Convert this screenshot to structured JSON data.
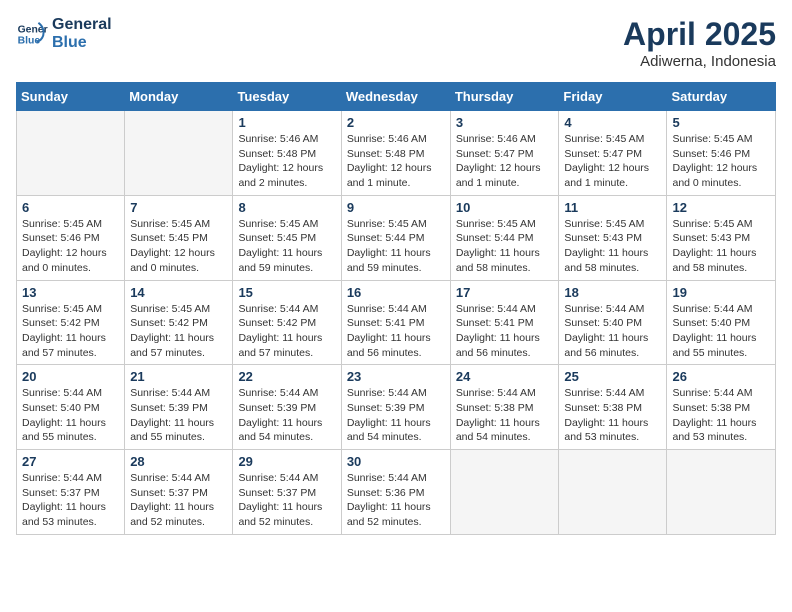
{
  "header": {
    "logo_line1": "General",
    "logo_line2": "Blue",
    "title": "April 2025",
    "subtitle": "Adiwerna, Indonesia"
  },
  "weekdays": [
    "Sunday",
    "Monday",
    "Tuesday",
    "Wednesday",
    "Thursday",
    "Friday",
    "Saturday"
  ],
  "weeks": [
    [
      {
        "day": "",
        "info": ""
      },
      {
        "day": "",
        "info": ""
      },
      {
        "day": "1",
        "info": "Sunrise: 5:46 AM\nSunset: 5:48 PM\nDaylight: 12 hours and 2 minutes."
      },
      {
        "day": "2",
        "info": "Sunrise: 5:46 AM\nSunset: 5:48 PM\nDaylight: 12 hours and 1 minute."
      },
      {
        "day": "3",
        "info": "Sunrise: 5:46 AM\nSunset: 5:47 PM\nDaylight: 12 hours and 1 minute."
      },
      {
        "day": "4",
        "info": "Sunrise: 5:45 AM\nSunset: 5:47 PM\nDaylight: 12 hours and 1 minute."
      },
      {
        "day": "5",
        "info": "Sunrise: 5:45 AM\nSunset: 5:46 PM\nDaylight: 12 hours and 0 minutes."
      }
    ],
    [
      {
        "day": "6",
        "info": "Sunrise: 5:45 AM\nSunset: 5:46 PM\nDaylight: 12 hours and 0 minutes."
      },
      {
        "day": "7",
        "info": "Sunrise: 5:45 AM\nSunset: 5:45 PM\nDaylight: 12 hours and 0 minutes."
      },
      {
        "day": "8",
        "info": "Sunrise: 5:45 AM\nSunset: 5:45 PM\nDaylight: 11 hours and 59 minutes."
      },
      {
        "day": "9",
        "info": "Sunrise: 5:45 AM\nSunset: 5:44 PM\nDaylight: 11 hours and 59 minutes."
      },
      {
        "day": "10",
        "info": "Sunrise: 5:45 AM\nSunset: 5:44 PM\nDaylight: 11 hours and 58 minutes."
      },
      {
        "day": "11",
        "info": "Sunrise: 5:45 AM\nSunset: 5:43 PM\nDaylight: 11 hours and 58 minutes."
      },
      {
        "day": "12",
        "info": "Sunrise: 5:45 AM\nSunset: 5:43 PM\nDaylight: 11 hours and 58 minutes."
      }
    ],
    [
      {
        "day": "13",
        "info": "Sunrise: 5:45 AM\nSunset: 5:42 PM\nDaylight: 11 hours and 57 minutes."
      },
      {
        "day": "14",
        "info": "Sunrise: 5:45 AM\nSunset: 5:42 PM\nDaylight: 11 hours and 57 minutes."
      },
      {
        "day": "15",
        "info": "Sunrise: 5:44 AM\nSunset: 5:42 PM\nDaylight: 11 hours and 57 minutes."
      },
      {
        "day": "16",
        "info": "Sunrise: 5:44 AM\nSunset: 5:41 PM\nDaylight: 11 hours and 56 minutes."
      },
      {
        "day": "17",
        "info": "Sunrise: 5:44 AM\nSunset: 5:41 PM\nDaylight: 11 hours and 56 minutes."
      },
      {
        "day": "18",
        "info": "Sunrise: 5:44 AM\nSunset: 5:40 PM\nDaylight: 11 hours and 56 minutes."
      },
      {
        "day": "19",
        "info": "Sunrise: 5:44 AM\nSunset: 5:40 PM\nDaylight: 11 hours and 55 minutes."
      }
    ],
    [
      {
        "day": "20",
        "info": "Sunrise: 5:44 AM\nSunset: 5:40 PM\nDaylight: 11 hours and 55 minutes."
      },
      {
        "day": "21",
        "info": "Sunrise: 5:44 AM\nSunset: 5:39 PM\nDaylight: 11 hours and 55 minutes."
      },
      {
        "day": "22",
        "info": "Sunrise: 5:44 AM\nSunset: 5:39 PM\nDaylight: 11 hours and 54 minutes."
      },
      {
        "day": "23",
        "info": "Sunrise: 5:44 AM\nSunset: 5:39 PM\nDaylight: 11 hours and 54 minutes."
      },
      {
        "day": "24",
        "info": "Sunrise: 5:44 AM\nSunset: 5:38 PM\nDaylight: 11 hours and 54 minutes."
      },
      {
        "day": "25",
        "info": "Sunrise: 5:44 AM\nSunset: 5:38 PM\nDaylight: 11 hours and 53 minutes."
      },
      {
        "day": "26",
        "info": "Sunrise: 5:44 AM\nSunset: 5:38 PM\nDaylight: 11 hours and 53 minutes."
      }
    ],
    [
      {
        "day": "27",
        "info": "Sunrise: 5:44 AM\nSunset: 5:37 PM\nDaylight: 11 hours and 53 minutes."
      },
      {
        "day": "28",
        "info": "Sunrise: 5:44 AM\nSunset: 5:37 PM\nDaylight: 11 hours and 52 minutes."
      },
      {
        "day": "29",
        "info": "Sunrise: 5:44 AM\nSunset: 5:37 PM\nDaylight: 11 hours and 52 minutes."
      },
      {
        "day": "30",
        "info": "Sunrise: 5:44 AM\nSunset: 5:36 PM\nDaylight: 11 hours and 52 minutes."
      },
      {
        "day": "",
        "info": ""
      },
      {
        "day": "",
        "info": ""
      },
      {
        "day": "",
        "info": ""
      }
    ]
  ]
}
